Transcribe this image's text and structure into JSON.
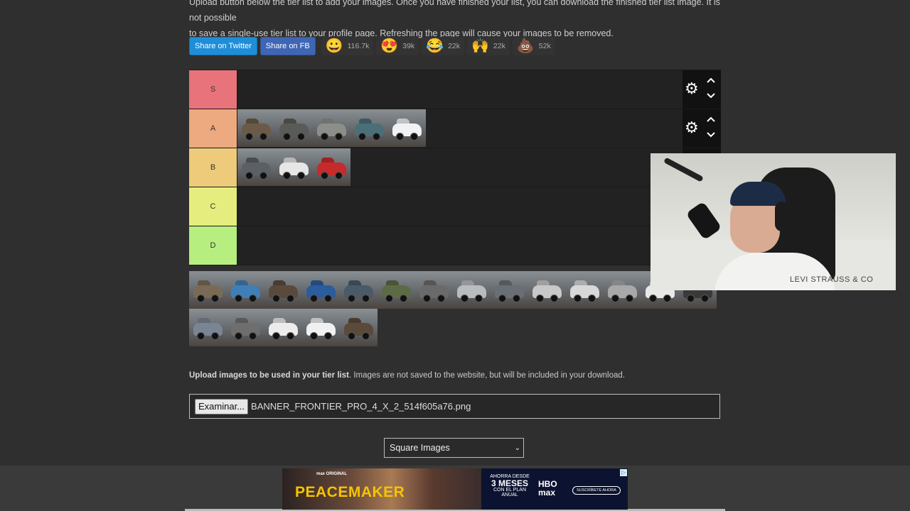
{
  "intro": {
    "line1": "Upload button below the tier list to add your images. Once you have finished your list, you can download the finished tier list image. It is not possible",
    "line2": "to save a single-use tier list to your profile page. Refreshing the page will cause your images to be removed."
  },
  "share": {
    "twitter_label": "Share on Twitter",
    "fb_label": "Share on FB",
    "reactions": [
      {
        "icon": "grinning-face",
        "emoji": "😀",
        "count": "116.7k"
      },
      {
        "icon": "heart-eyes-face",
        "emoji": "😍",
        "count": "39k"
      },
      {
        "icon": "tears-of-joy-face",
        "emoji": "😂",
        "count": "22k"
      },
      {
        "icon": "raised-hands",
        "emoji": "🙌",
        "count": "22k"
      },
      {
        "icon": "pile-of-poo",
        "emoji": "💩",
        "count": "52k"
      }
    ]
  },
  "tiers": [
    {
      "label": "S",
      "color": "#e8737a",
      "items": []
    },
    {
      "label": "A",
      "color": "#eda97f",
      "items": [
        "#6b5a47",
        "#5a5a58",
        "#8c8e8a",
        "#4a6f78",
        "#f2f2f2"
      ]
    },
    {
      "label": "B",
      "color": "#eecb7b",
      "items": [
        "#5b6067",
        "#e6e6e6",
        "#c62a2a"
      ]
    },
    {
      "label": "C",
      "color": "#e6ed7f",
      "items": []
    },
    {
      "label": "D",
      "color": "#b6ee7f",
      "items": []
    }
  ],
  "pool": {
    "items": [
      "#7a6a55",
      "#3f7fb5",
      "#5a4a3c",
      "#2a5c9e",
      "#4a5a66",
      "#5c6a45",
      "#6a6a6a",
      "#b9bcbf",
      "#6a6f75",
      "#c8c8c8",
      "#d8d8d8",
      "#a8a8a8",
      "#e8e8e8",
      "#3a3a3a",
      "#7a8594",
      "#6e6e6e",
      "#ececec",
      "#f0f0f0",
      "#5a4a3a"
    ]
  },
  "webcam": {
    "shirt_text": "LEVI STRAUSS & CO"
  },
  "upload": {
    "bold_text": "Upload images to be used in your tier list",
    "rest_text": ". Images are not saved to the website, but will be included in your download.",
    "button_label": "Examinar...",
    "file_name": "BANNER_FRONTIER_PRO_4_X_2_514f605a76.png"
  },
  "image_mode": {
    "selected": "Square Images"
  },
  "ad": {
    "brand_tag": "max ORIGINAL",
    "title": "PEACEMAKER",
    "promo_small_top": "AHORRA DESDE",
    "promo_big": "3 MESES",
    "promo_small_bottom": "CON EL PLAN ANUAL",
    "logo_line1": "HBO",
    "logo_line2": "max",
    "cta": "SUSCRÍBETE AHORA"
  }
}
